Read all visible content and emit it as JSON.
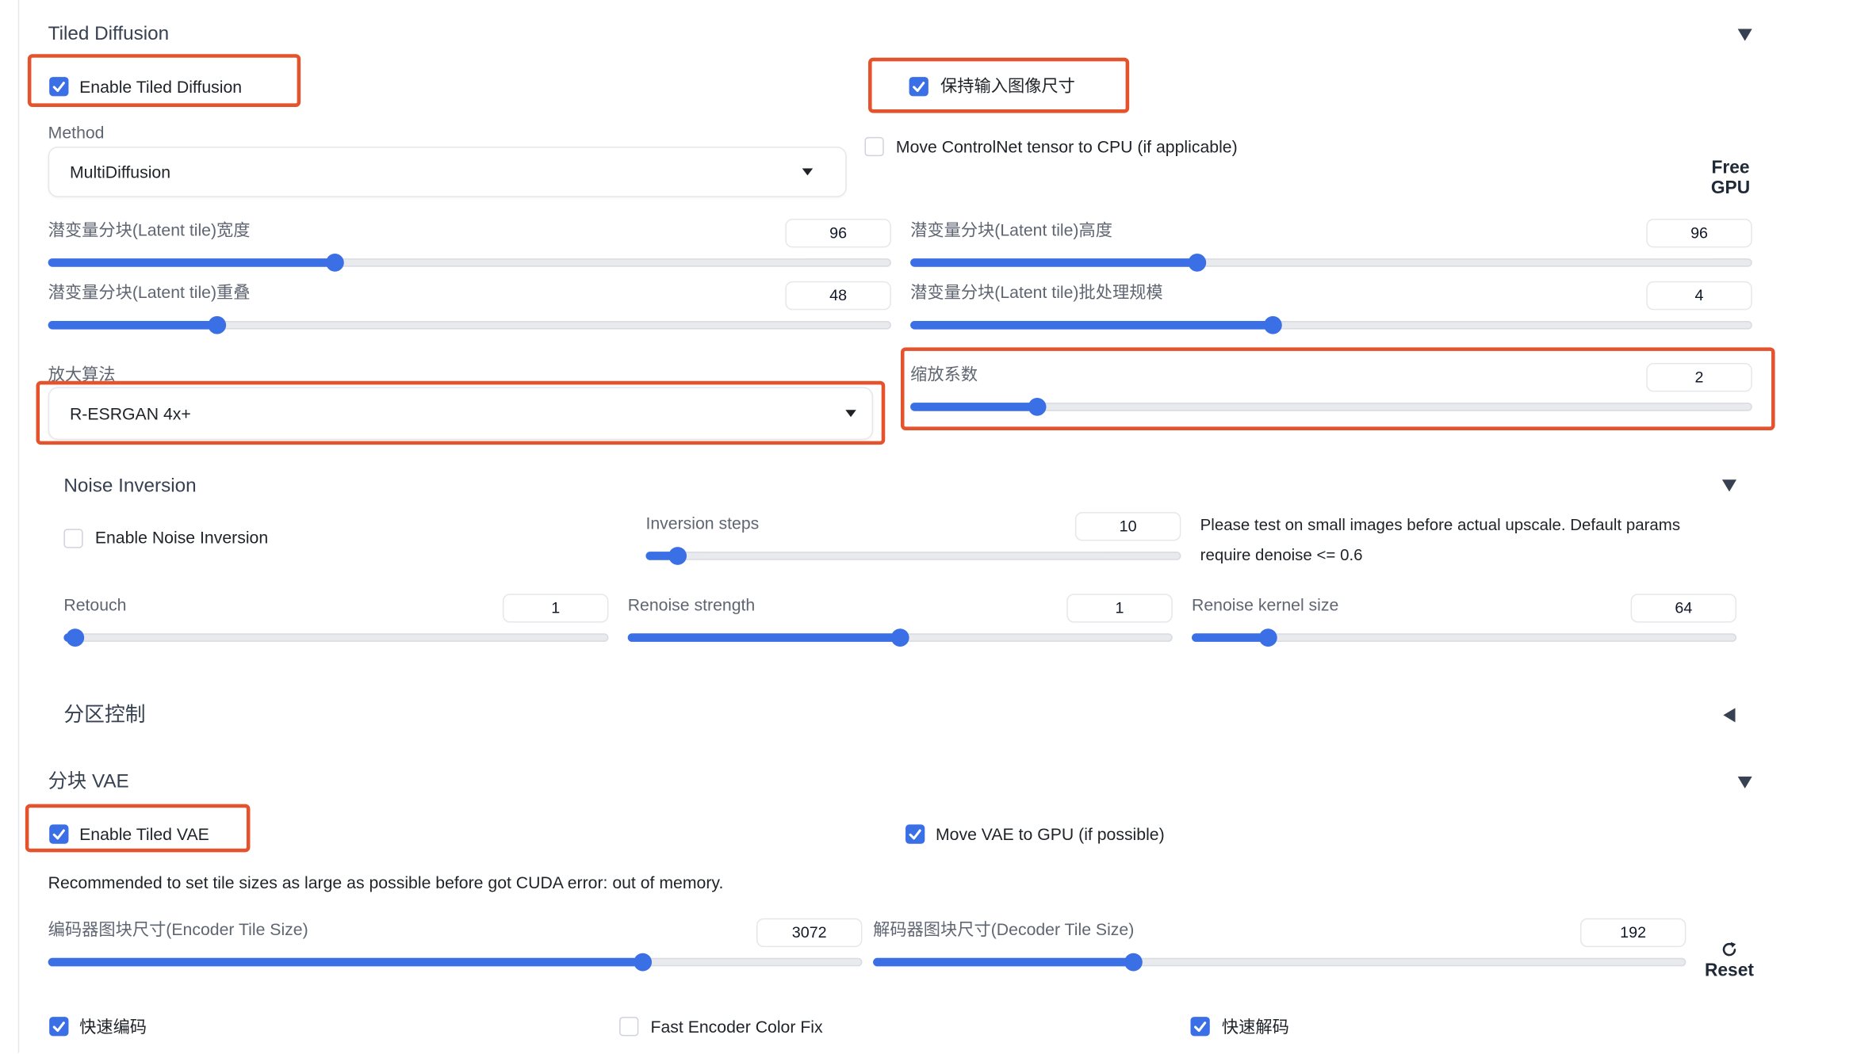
{
  "colors": {
    "accent": "#3b6fe6",
    "highlight_box": "#e5532c",
    "text": "#1f2328",
    "label": "#5f6672",
    "track": "#e9eaee"
  },
  "tiled_diffusion": {
    "title": "Tiled Diffusion",
    "toggle_icon": "triangle-down-icon",
    "enable_tiled_diffusion": {
      "label": "Enable Tiled Diffusion",
      "checked": true
    },
    "keep_input_size": {
      "label": "保持输入图像尺寸",
      "checked": true
    },
    "move_controlnet_to_cpu": {
      "label": "Move ControlNet tensor to CPU (if applicable)",
      "checked": false
    },
    "free_gpu_button": {
      "label": "Free GPU"
    },
    "method": {
      "label": "Method",
      "value": "MultiDiffusion",
      "icon": "caret-down-icon"
    },
    "latent_tile_width": {
      "label": "潜变量分块(Latent tile)宽度",
      "value": "96",
      "level": 0.34
    },
    "latent_tile_height": {
      "label": "潜变量分块(Latent tile)高度",
      "value": "96",
      "level": 0.34
    },
    "latent_tile_overlap": {
      "label": "潜变量分块(Latent tile)重叠",
      "value": "48",
      "level": 0.2
    },
    "latent_tile_batch_size": {
      "label": "潜变量分块(Latent tile)批处理规模",
      "value": "4",
      "level": 0.43
    },
    "upscaler": {
      "label": "放大算法",
      "value": "R-ESRGAN 4x+",
      "icon": "caret-down-icon"
    },
    "scale_factor": {
      "label": "缩放系数",
      "value": "2",
      "level": 0.15
    }
  },
  "noise_inversion": {
    "title": "Noise Inversion",
    "toggle_icon": "triangle-down-icon",
    "enable": {
      "label": "Enable Noise Inversion",
      "checked": false
    },
    "inversion_steps": {
      "label": "Inversion steps",
      "value": "10",
      "level": 0.06
    },
    "note_line1": "Please test on small images before actual upscale. Default params",
    "note_line2": "require denoise <= 0.6",
    "retouch": {
      "label": "Retouch",
      "value": "1",
      "level": 0.02
    },
    "renoise_strength": {
      "label": "Renoise strength",
      "value": "1",
      "level": 0.5
    },
    "renoise_kernel_size": {
      "label": "Renoise kernel size",
      "value": "64",
      "level": 0.14
    }
  },
  "region_control": {
    "title": "分区控制",
    "toggle_icon": "triangle-left-icon"
  },
  "tiled_vae": {
    "title": "分块 VAE",
    "toggle_icon": "triangle-down-icon",
    "enable": {
      "label": "Enable Tiled VAE",
      "checked": true
    },
    "move_vae_to_gpu": {
      "label": "Move VAE to GPU (if possible)",
      "checked": true
    },
    "recommendation": "Recommended to set tile sizes as large as possible before got CUDA error: out of memory.",
    "encoder_tile_size": {
      "label": "编码器图块尺寸(Encoder Tile Size)",
      "value": "3072",
      "level": 0.73
    },
    "decoder_tile_size": {
      "label": "解码器图块尺寸(Decoder Tile Size)",
      "value": "192",
      "level": 0.32
    },
    "reset_button": {
      "label": "Reset",
      "icon": "refresh-icon"
    },
    "fast_encoder": {
      "label": "快速编码",
      "checked": true
    },
    "fast_encoder_color_fix": {
      "label": "Fast Encoder Color Fix",
      "checked": false
    },
    "fast_decoder": {
      "label": "快速解码",
      "checked": true
    }
  }
}
